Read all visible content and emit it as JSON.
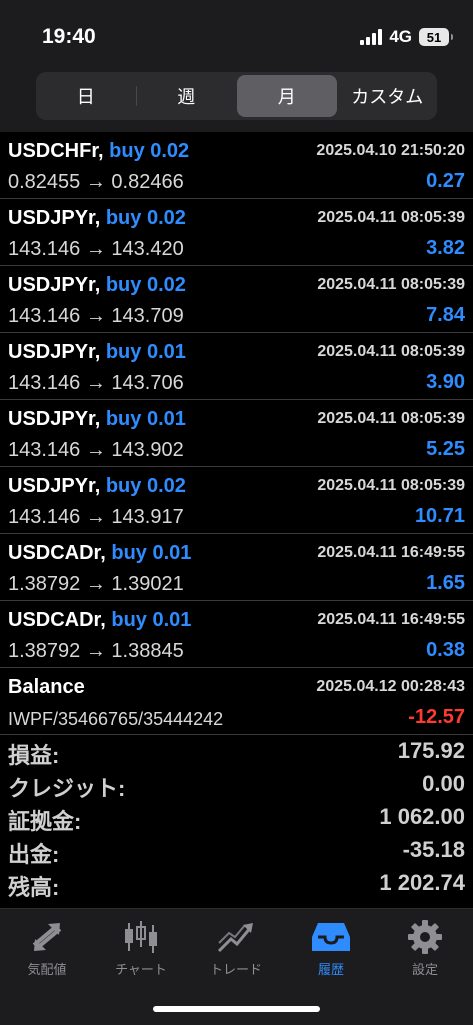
{
  "status_bar": {
    "time": "19:40",
    "network": "4G",
    "battery": "51"
  },
  "segments": [
    {
      "label": "日",
      "selected": false
    },
    {
      "label": "週",
      "selected": false
    },
    {
      "label": "月",
      "selected": true
    },
    {
      "label": "カスタム",
      "selected": false
    }
  ],
  "deals": [
    {
      "symbol": "USDCHFr,",
      "side": "buy 0.02",
      "time": "2025.04.10 21:50:20",
      "prices": "0.82455 → 0.82466",
      "profit": "0.27"
    },
    {
      "symbol": "USDJPYr,",
      "side": "buy 0.02",
      "time": "2025.04.11 08:05:39",
      "prices": "143.146 → 143.420",
      "profit": "3.82"
    },
    {
      "symbol": "USDJPYr,",
      "side": "buy 0.02",
      "time": "2025.04.11 08:05:39",
      "prices": "143.146 → 143.709",
      "profit": "7.84"
    },
    {
      "symbol": "USDJPYr,",
      "side": "buy 0.01",
      "time": "2025.04.11 08:05:39",
      "prices": "143.146 → 143.706",
      "profit": "3.90"
    },
    {
      "symbol": "USDJPYr,",
      "side": "buy 0.01",
      "time": "2025.04.11 08:05:39",
      "prices": "143.146 → 143.902",
      "profit": "5.25"
    },
    {
      "symbol": "USDJPYr,",
      "side": "buy 0.02",
      "time": "2025.04.11 08:05:39",
      "prices": "143.146 → 143.917",
      "profit": "10.71"
    },
    {
      "symbol": "USDCADr,",
      "side": "buy 0.01",
      "time": "2025.04.11 16:49:55",
      "prices": "1.38792 → 1.39021",
      "profit": "1.65"
    },
    {
      "symbol": "USDCADr,",
      "side": "buy 0.01",
      "time": "2025.04.11 16:49:55",
      "prices": "1.38792 → 1.38845",
      "profit": "0.38"
    }
  ],
  "balance": {
    "label": "Balance",
    "time": "2025.04.12 00:28:43",
    "comment": "IWPF/35466765/35444242",
    "amount": "-12.57"
  },
  "summary": [
    {
      "label": "損益:",
      "value": "175.92"
    },
    {
      "label": "クレジット:",
      "value": "0.00"
    },
    {
      "label": "証拠金:",
      "value": "1 062.00"
    },
    {
      "label": "出金:",
      "value": "-35.18"
    },
    {
      "label": "残高:",
      "value": "1 202.74"
    }
  ],
  "tabs": [
    {
      "label": "気配値",
      "icon": "quotes-icon",
      "active": false
    },
    {
      "label": "チャート",
      "icon": "chart-icon",
      "active": false
    },
    {
      "label": "トレード",
      "icon": "trade-icon",
      "active": false
    },
    {
      "label": "履歴",
      "icon": "history-icon",
      "active": true
    },
    {
      "label": "設定",
      "icon": "settings-icon",
      "active": false
    }
  ],
  "colors": {
    "accent": "#2f8cff",
    "negative": "#ff3b30",
    "background": "#000000",
    "bar": "#1c1c1e"
  }
}
